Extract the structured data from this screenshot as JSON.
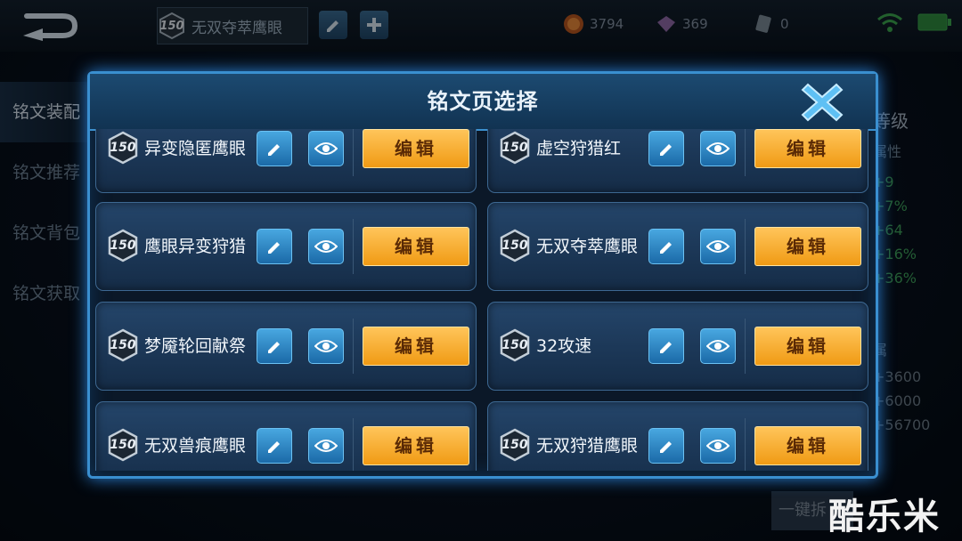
{
  "topbar": {
    "current_rune_page": {
      "level": "150",
      "name": "无双夺萃鹰眼"
    },
    "currencies": [
      {
        "name": "gold-coin-icon",
        "value": "3794"
      },
      {
        "name": "diamond-icon",
        "value": "369"
      },
      {
        "name": "voucher-icon",
        "value": "0"
      }
    ]
  },
  "side_nav": [
    "铭文装配",
    "铭文推荐",
    "铭文背包",
    "铭文获取"
  ],
  "stats": {
    "heading": "等级",
    "sub": "属性",
    "values": [
      "+9",
      "+7%",
      "+64",
      "+16%",
      "+36%"
    ],
    "sub2": "属",
    "values2": [
      "+3600",
      "+6000",
      "+56700"
    ]
  },
  "one_click_label": "一键拆",
  "watermark": "酷乐米",
  "modal": {
    "title": "铭文页选择",
    "edit_label": "编辑",
    "pages": [
      {
        "level": "150",
        "name": "异变隐匿鹰眼"
      },
      {
        "level": "150",
        "name": "虚空狩猎红"
      },
      {
        "level": "150",
        "name": "鹰眼异变狩猎"
      },
      {
        "level": "150",
        "name": "无双夺萃鹰眼"
      },
      {
        "level": "150",
        "name": "梦魇轮回献祭"
      },
      {
        "level": "150",
        "name": "32攻速"
      },
      {
        "level": "150",
        "name": "无双兽痕鹰眼"
      },
      {
        "level": "150",
        "name": "无双狩猎鹰眼"
      }
    ]
  },
  "colors": {
    "accent": "#3a8fd0",
    "edit_button": "#f5a623",
    "stat_green": "#3e9f5b"
  }
}
